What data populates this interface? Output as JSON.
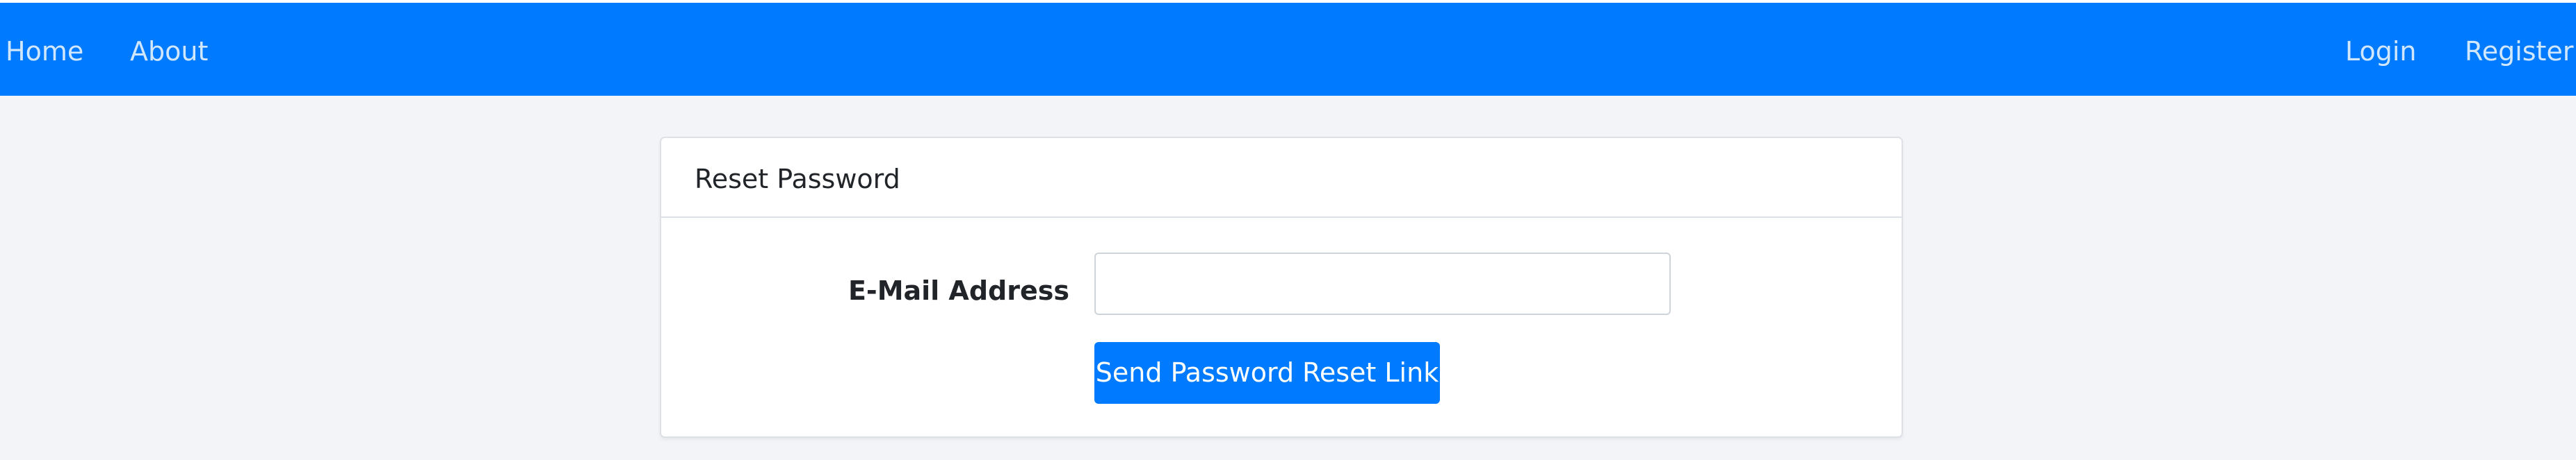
{
  "navbar": {
    "left_links": [
      {
        "label": "Home"
      },
      {
        "label": "About"
      }
    ],
    "right_links": [
      {
        "label": "Login"
      },
      {
        "label": "Register"
      }
    ],
    "color": "#007bff"
  },
  "card": {
    "title": "Reset Password",
    "email": {
      "label": "E-Mail Address",
      "value": "",
      "placeholder": ""
    },
    "submit_label": "Send Password Reset Link"
  },
  "colors": {
    "primary": "#007bff",
    "page_background": "#f3f4f8",
    "card_background": "#ffffff"
  }
}
